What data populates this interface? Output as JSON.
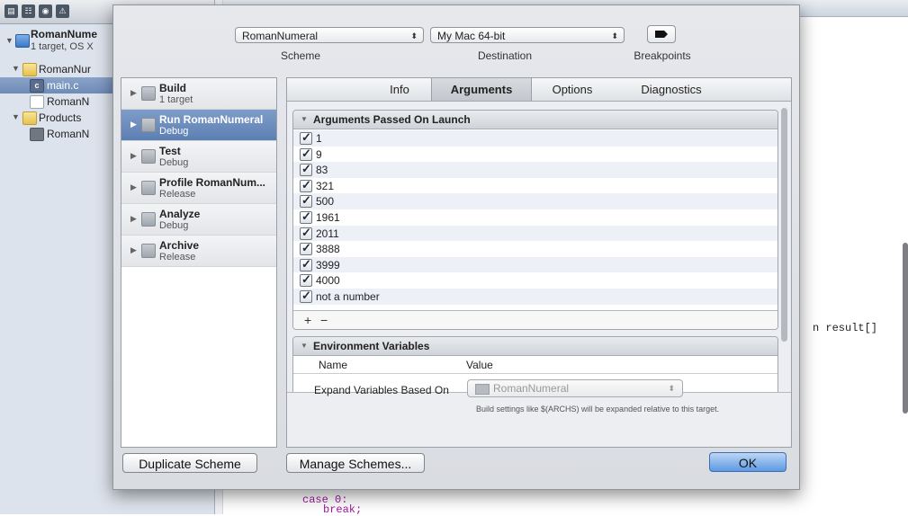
{
  "navigator": {
    "project_name": "RomanNume",
    "project_subtitle": "1 target, OS X",
    "group_name": "RomanNur",
    "files": [
      "main.c",
      "RomanN"
    ],
    "products_label": "Products",
    "product_item": "RomanN"
  },
  "editor": {
    "fragment_result": "n result[]",
    "case_line": "case 0:",
    "break_line": "break;"
  },
  "scheme_sheet": {
    "scheme_popup": "RomanNumeral",
    "scheme_label": "Scheme",
    "destination_popup": "My Mac 64-bit",
    "destination_label": "Destination",
    "breakpoints_label": "Breakpoints",
    "actions": [
      {
        "title": "Build",
        "subtitle": "1 target"
      },
      {
        "title": "Run RomanNumeral",
        "subtitle": "Debug"
      },
      {
        "title": "Test",
        "subtitle": "Debug"
      },
      {
        "title": "Profile RomanNum...",
        "subtitle": "Release"
      },
      {
        "title": "Analyze",
        "subtitle": "Debug"
      },
      {
        "title": "Archive",
        "subtitle": "Release"
      }
    ],
    "tabs": [
      "Info",
      "Arguments",
      "Options",
      "Diagnostics"
    ],
    "active_tab": "Arguments",
    "arguments_header": "Arguments Passed On Launch",
    "arguments": [
      "1",
      "9",
      "83",
      "321",
      "500",
      "1961",
      "2011",
      "3888",
      "3999",
      "4000",
      "not a number"
    ],
    "add_symbol": "+",
    "remove_symbol": "−",
    "env_header": "Environment Variables",
    "env_columns": {
      "name": "Name",
      "value": "Value"
    },
    "expand_label": "Expand Variables Based On",
    "expand_value": "RomanNumeral",
    "expand_help": "Build settings like $(ARCHS) will be expanded relative to this target.",
    "duplicate_button": "Duplicate Scheme",
    "manage_button": "Manage Schemes...",
    "ok_button": "OK"
  }
}
